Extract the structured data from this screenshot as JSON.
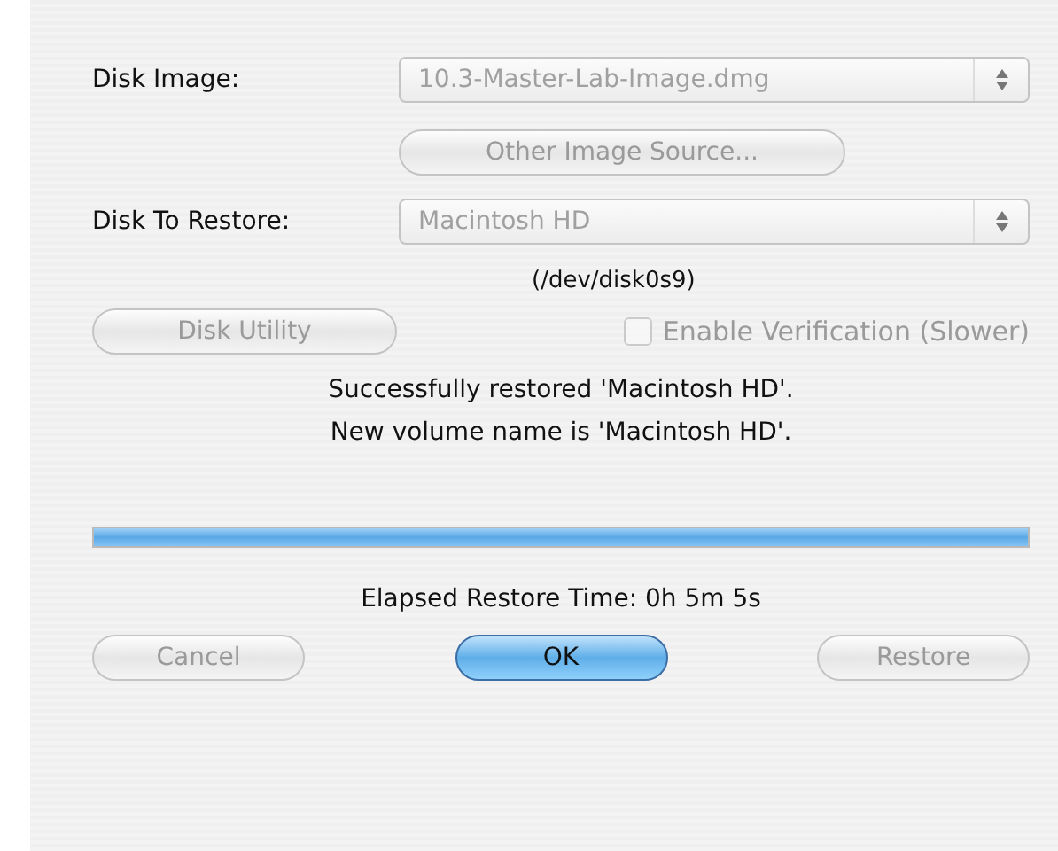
{
  "disk_image": {
    "label": "Disk Image:",
    "value": "10.3-Master-Lab-Image.dmg",
    "disabled": true
  },
  "other_source_button": {
    "label": "Other Image Source...",
    "disabled": true,
    "default": false
  },
  "disk_to_restore": {
    "label": "Disk To Restore:",
    "value": "Macintosh HD",
    "disabled": true
  },
  "device_path": "(/dev/disk0s9)",
  "disk_utility_button": {
    "label": "Disk Utility",
    "disabled": true,
    "default": false
  },
  "verification": {
    "label": "Enable Verification (Slower)",
    "checked": false,
    "disabled": true
  },
  "messages": [
    "Successfully restored 'Macintosh HD'.",
    "New volume name is 'Macintosh HD'."
  ],
  "progress": {
    "level": 1
  },
  "elapsed": "Elapsed Restore Time: 0h 5m 5s",
  "buttons": [
    {
      "label": "Cancel",
      "disabled": true,
      "default": false
    },
    {
      "label": "OK",
      "disabled": false,
      "default": true
    },
    {
      "label": "Restore",
      "disabled": true,
      "default": false
    }
  ]
}
